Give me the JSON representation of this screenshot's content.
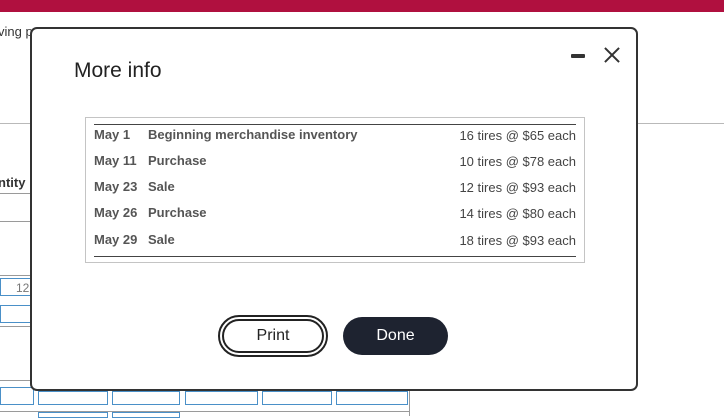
{
  "background": {
    "partial_text_1": "ving p",
    "partial_text_2": "ntity",
    "partial_number": "12",
    "accent_color": "#b0103f"
  },
  "modal": {
    "title": "More info",
    "rows": [
      {
        "date": "May 1",
        "description": "Beginning merchandise inventory",
        "detail": "16 tires @ $65 each"
      },
      {
        "date": "May 11",
        "description": "Purchase",
        "detail": "10 tires @ $78 each"
      },
      {
        "date": "May 23",
        "description": "Sale",
        "detail": "12 tires @ $93 each"
      },
      {
        "date": "May 26",
        "description": "Purchase",
        "detail": "14 tires @ $80 each"
      },
      {
        "date": "May 29",
        "description": "Sale",
        "detail": "18 tires @ $93 each"
      }
    ],
    "print_label": "Print",
    "done_label": "Done"
  }
}
